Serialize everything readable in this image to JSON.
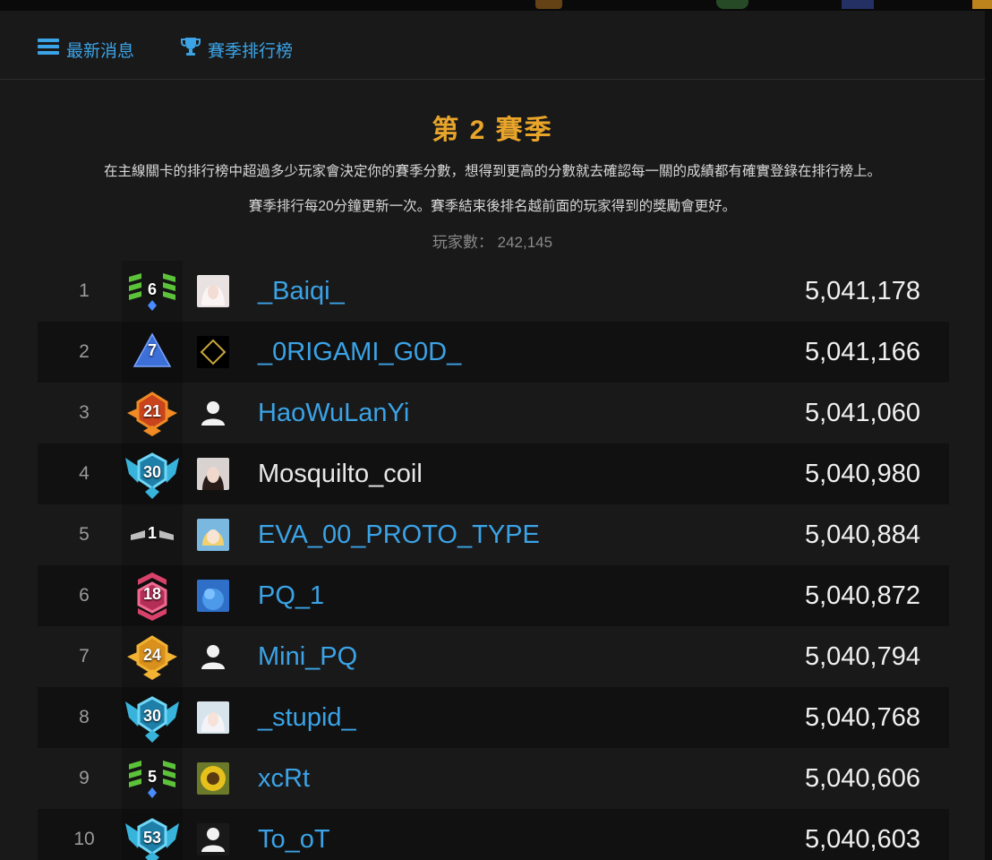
{
  "nav": {
    "news_label": "最新消息",
    "news_icon": "menu-icon",
    "ranking_label": "賽季排行榜",
    "ranking_icon": "trophy-icon"
  },
  "season": {
    "title": "第 2 賽季",
    "description_1": "在主線關卡的排行榜中超過多少玩家會決定你的賽季分數，想得到更高的分數就去確認每一關的成績都有確實登錄在排行榜上。",
    "description_2": "賽季排行每20分鐘更新一次。賽季結束後排名越前面的玩家得到的獎勵會更好。",
    "player_count_label": "玩家數：",
    "player_count": "242,145"
  },
  "colors": {
    "accent_blue": "#3ba3e6",
    "title_gold": "#e9a52a",
    "name_white": "#e8e8e8"
  },
  "leaderboard": [
    {
      "rank": "1",
      "badge_number": "6",
      "badge_type": "green-stripes-badge",
      "avatar": "anime-girl-avatar",
      "name": "_Baiqi_",
      "name_color": "#3ba3e6",
      "score": "5,041,178"
    },
    {
      "rank": "2",
      "badge_number": "7",
      "badge_type": "blue-triangle-badge",
      "avatar": "diamond-avatar",
      "name": "_0RIGAMI_G0D_",
      "name_color": "#3ba3e6",
      "score": "5,041,166"
    },
    {
      "rank": "3",
      "badge_number": "21",
      "badge_type": "orange-winged-badge",
      "avatar": "default-user-avatar",
      "name": "HaoWuLanYi",
      "name_color": "#3ba3e6",
      "score": "5,041,060"
    },
    {
      "rank": "4",
      "badge_number": "30",
      "badge_type": "cyan-winged-badge",
      "avatar": "girl-portrait-avatar",
      "name": "Mosquilto_coil",
      "name_color": "#e8e8e8",
      "score": "5,040,980"
    },
    {
      "rank": "5",
      "badge_number": "1",
      "badge_type": "gray-small-badge",
      "avatar": "anime-blonde-avatar",
      "name": "EVA_00_PROTO_TYPE",
      "name_color": "#3ba3e6",
      "score": "5,040,884"
    },
    {
      "rank": "6",
      "badge_number": "18",
      "badge_type": "pink-chevron-badge",
      "avatar": "blue-sky-avatar",
      "name": "PQ_1",
      "name_color": "#3ba3e6",
      "score": "5,040,872"
    },
    {
      "rank": "7",
      "badge_number": "24",
      "badge_type": "gold-winged-badge",
      "avatar": "default-user-avatar",
      "name": "Mini_PQ",
      "name_color": "#3ba3e6",
      "score": "5,040,794"
    },
    {
      "rank": "8",
      "badge_number": "30",
      "badge_type": "cyan-winged-badge",
      "avatar": "anime-white-hair-avatar",
      "name": "_stupid_",
      "name_color": "#3ba3e6",
      "score": "5,040,768"
    },
    {
      "rank": "9",
      "badge_number": "5",
      "badge_type": "green-stripes-badge",
      "avatar": "sunflower-avatar",
      "name": "xcRt",
      "name_color": "#3ba3e6",
      "score": "5,040,606"
    },
    {
      "rank": "10",
      "badge_number": "53",
      "badge_type": "cyan-winged-badge",
      "avatar": "default-user-avatar",
      "name": "To_oT",
      "name_color": "#3ba3e6",
      "score": "5,040,603"
    }
  ]
}
